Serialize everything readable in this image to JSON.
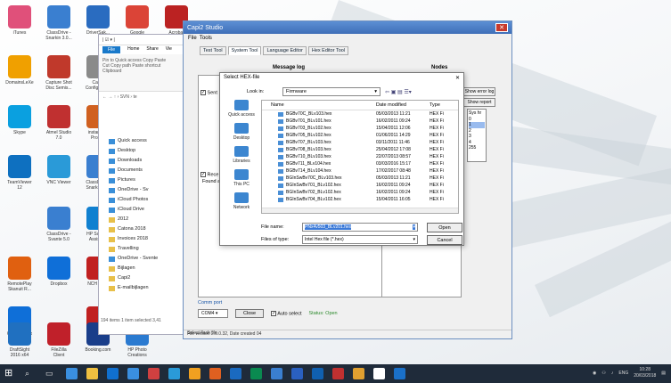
{
  "desktop_icons": [
    {
      "label": "iTunes",
      "color": "#e0507a"
    },
    {
      "label": "ClassDrive -\nSnarkin 3.0...",
      "color": "#3a7fd0"
    },
    {
      "label": "DriverSak...",
      "color": "#2a6cc0"
    },
    {
      "label": "Google\nChrome",
      "color": "#db4437"
    },
    {
      "label": "Acrobat",
      "color": "#b22"
    },
    {
      "label": "DomainsLeXe",
      "color": "#f0a000"
    },
    {
      "label": "Capture Shot\nDisc Semis...",
      "color": "#c0392b"
    },
    {
      "label": "Capi2\nConfigurati...",
      "color": "#8a8a8a"
    },
    {
      "label": "Skype",
      "color": "#0aa0e0"
    },
    {
      "label": "Atmel Studio\n7.0",
      "color": "#c03030"
    },
    {
      "label": "instantidjp\nPro 3.0",
      "color": "#d06020"
    },
    {
      "label": "TeamViewer\n12",
      "color": "#0e70c0"
    },
    {
      "label": "VNC Viewer",
      "color": "#2a9ad8"
    },
    {
      "label": "ClassDrive -\nSnarkin BJL",
      "color": "#3a7fd0"
    },
    {
      "label": "ClassDrive -\nSvante 5.0",
      "color": "#3a7fd0"
    },
    {
      "label": "HP Support\nAssistant",
      "color": "#1080d0"
    },
    {
      "label": "Dropbox",
      "color": "#0f6fd8"
    },
    {
      "label": "NCH Suite",
      "color": "#c02020"
    },
    {
      "label": "RemotePlay\nSkanuit R...",
      "color": "#e06010"
    },
    {
      "label": "Get Dropbox",
      "color": "#0f6fd8"
    },
    {
      "label": "NCH Suite",
      "color": "#c02020"
    },
    {
      "label": "DraftSight\n2016 x64",
      "color": "#2070c0"
    },
    {
      "label": "FileZilla\nClient",
      "color": "#c0202a"
    },
    {
      "label": "Booking.com",
      "color": "#1a3e8a"
    },
    {
      "label": "HP Photo\nCreations",
      "color": "#2a7ad0"
    }
  ],
  "explorer": {
    "toolbar_text": "| ☑ ▾ |",
    "ribbon_tabs": [
      "File",
      "Home",
      "Share",
      "Vie"
    ],
    "ribbon_items": [
      "Pin to Quick access",
      "Copy",
      "Paste",
      "Cut",
      "Copy path",
      "Paste shortcut",
      "Clipboard"
    ],
    "address": "← → ↑  › SVN › te",
    "nav_items": [
      {
        "label": "Quick access",
        "blue": true
      },
      {
        "label": "Desktop",
        "blue": true
      },
      {
        "label": "Downloads",
        "blue": true
      },
      {
        "label": "Documents",
        "blue": true
      },
      {
        "label": "Pictures",
        "blue": true
      },
      {
        "label": "OneDrive - Sv",
        "blue": true
      },
      {
        "label": "iCloud Photos",
        "blue": true
      },
      {
        "label": "iCloud Drive",
        "blue": true
      },
      {
        "label": "2012",
        "blue": false
      },
      {
        "label": "Catona 2018",
        "blue": false
      },
      {
        "label": "Invoices 2018",
        "blue": false
      },
      {
        "label": "Travelling",
        "blue": false
      },
      {
        "label": "OneDrive - Svente",
        "blue": true
      },
      {
        "label": "Bijlagen",
        "blue": false
      },
      {
        "label": "Capi2",
        "blue": false
      },
      {
        "label": "E-mailbijlagen",
        "blue": false
      }
    ],
    "status": "194 items   1 item selected 3,41"
  },
  "capi": {
    "title": "Capi2 Studio",
    "menu": [
      "File",
      "Tools"
    ],
    "tabs": [
      "Test Tool",
      "System Tool",
      "Language Editor",
      "Hex Editor Tool"
    ],
    "message_log_label": "Message log",
    "nodes_label": "Nodes",
    "sent_label": "Sent",
    "receive_label": "Rece",
    "found_text": "Found a",
    "show_error_log": "Show error log",
    "show_report": "Show report",
    "node_list": [
      "Sys hr",
      "0",
      "1",
      "2",
      "3",
      "4",
      "255"
    ],
    "comm_port_label": "Comm port",
    "comm_value": "COM4",
    "close_btn": "Close",
    "auto_select": "Auto select",
    "status_text": "Status: Open",
    "footer_version": "File version 2.0.0.32, Date created 04",
    "footer_select": "Select flash file"
  },
  "hex_dialog": {
    "title": "Select HEX-file",
    "look_in_label": "Look in:",
    "look_in_value": "Firmware",
    "places": [
      "Quick access",
      "Desktop",
      "Libraries",
      "This PC",
      "Network"
    ],
    "columns": [
      "Name",
      "Date modified",
      "Type"
    ],
    "files": [
      {
        "name": "BGBv70C_BLv103.hex",
        "date": "05/03/2013 11:21",
        "type": "HEX Fi"
      },
      {
        "name": "BGBv701_BLv101.hex",
        "date": "16/02/2011 09:24",
        "type": "HEX Fi"
      },
      {
        "name": "BGBv703_BLv102.hex",
        "date": "15/04/2011 12:06",
        "type": "HEX Fi"
      },
      {
        "name": "BGBv705_BLv102.hex",
        "date": "01/06/2011 14:29",
        "type": "HEX Fi"
      },
      {
        "name": "BGBv707_BLv103.hex",
        "date": "03/11/2011 11:46",
        "type": "HEX Fi"
      },
      {
        "name": "BGBv708_BLv103.hex",
        "date": "25/04/2012 17:08",
        "type": "HEX Fi"
      },
      {
        "name": "BGBv710_BLv103.hex",
        "date": "22/07/2013 08:57",
        "type": "HEX Fi"
      },
      {
        "name": "BGBv711_BLv104.hex",
        "date": "03/03/2016 15:17",
        "type": "HEX Fi"
      },
      {
        "name": "BGBv714_BLv104.hex",
        "date": "17/02/2017 08:48",
        "type": "HEX Fi"
      },
      {
        "name": "BGInSwBv70C_BLv103.hex",
        "date": "05/03/2013 11:21",
        "type": "HEX Fi"
      },
      {
        "name": "BGInSwBv701_BLv102.hex",
        "date": "16/02/2011 09:24",
        "type": "HEX Fi"
      },
      {
        "name": "BGInSwBv702_BLv102.hex",
        "date": "16/02/2011 09:24",
        "type": "HEX Fi"
      },
      {
        "name": "BGInSwBv704_BLv102.hex",
        "date": "15/04/2011 16:05",
        "type": "HEX Fi"
      }
    ],
    "file_name_label": "File name:",
    "file_name_value": "PNx4v503_BLv201.hex",
    "file_type_label": "Files of type:",
    "file_type_value": "Intel Hex file (*.hex)",
    "open_btn": "Open",
    "cancel_btn": "Cancel"
  },
  "taskbar": {
    "apps": [
      "#3a8fe0",
      "#f0c040",
      "#1070d0",
      "#3a8fe0",
      "#d04040",
      "#2a9ad8",
      "#f0a020",
      "#e06020",
      "#1a6ac0",
      "#0a8a50",
      "#3a7fd0",
      "#2a60c0",
      "#1060b0",
      "#c03030",
      "#e0a030",
      "#ffffff",
      "#1a70c8"
    ],
    "tray_lang": "ENG",
    "time": "10:28",
    "date": "20/03/2018"
  }
}
